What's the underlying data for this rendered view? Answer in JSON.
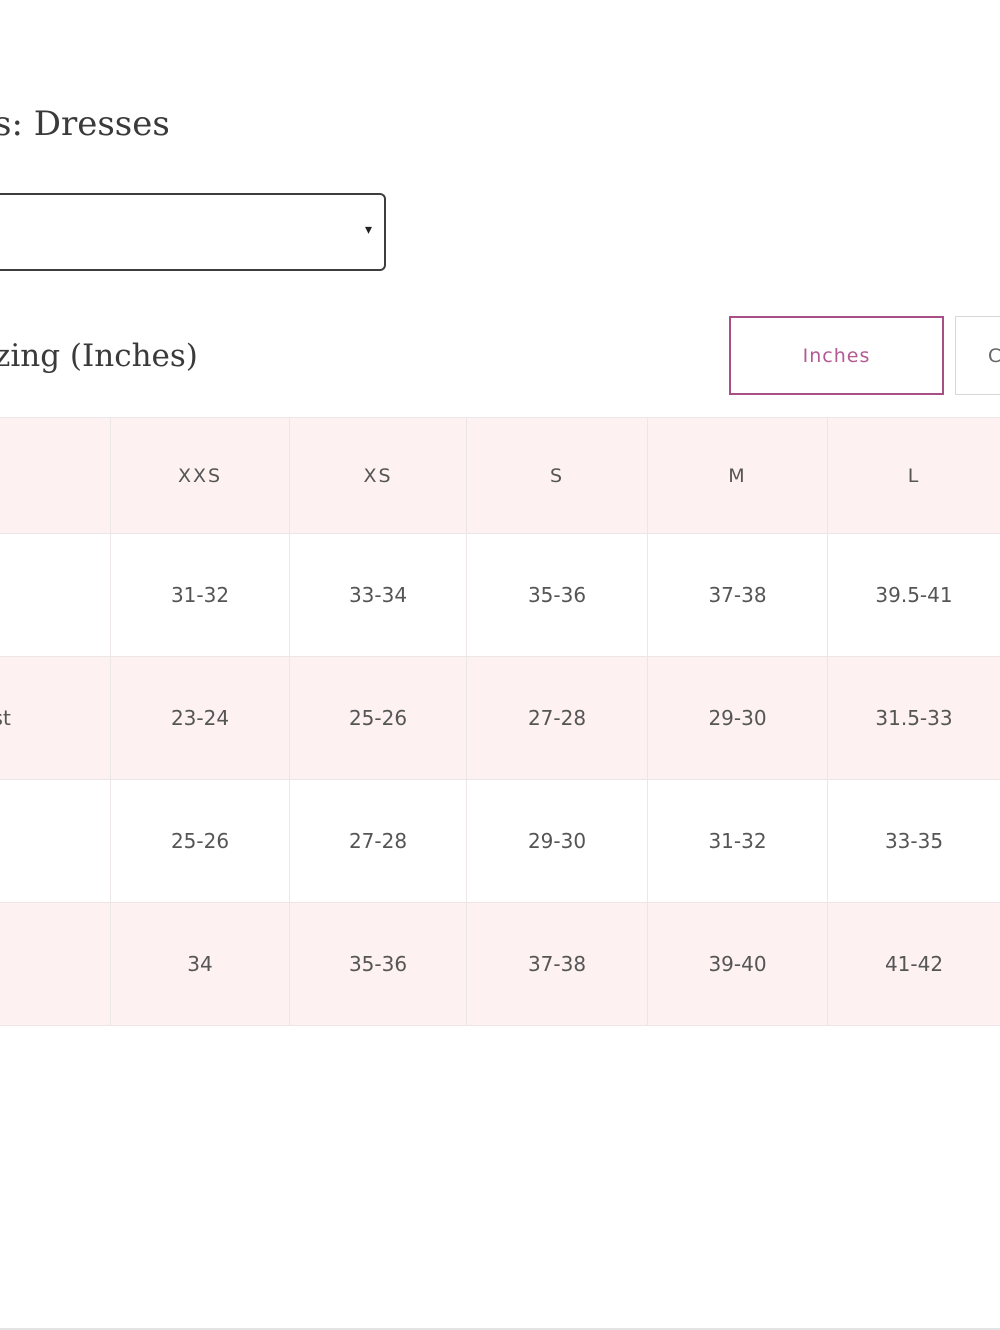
{
  "header": {
    "title": "s: Dresses",
    "subtitle": "zing (Inches)"
  },
  "size_select": {
    "value": "",
    "caret": "▾"
  },
  "unit_toggle": {
    "inches_label": "Inches",
    "other_label": "C",
    "active": "Inches",
    "accent_color": "#b45a92"
  },
  "table": {
    "columns": [
      "",
      "XXS",
      "XS",
      "S",
      "M",
      "L"
    ],
    "rows": [
      {
        "label": "",
        "values": [
          "31-32",
          "33-34",
          "35-36",
          "37-38",
          "39.5-41"
        ]
      },
      {
        "label": "ist",
        "values": [
          "23-24",
          "25-26",
          "27-28",
          "29-30",
          "31.5-33"
        ]
      },
      {
        "label": "",
        "values": [
          "25-26",
          "27-28",
          "29-30",
          "31-32",
          "33-35"
        ]
      },
      {
        "label": "",
        "values": [
          "34",
          "35-36",
          "37-38",
          "39-40",
          "41-42"
        ]
      }
    ],
    "stripe_color": "#fdf1f1"
  }
}
